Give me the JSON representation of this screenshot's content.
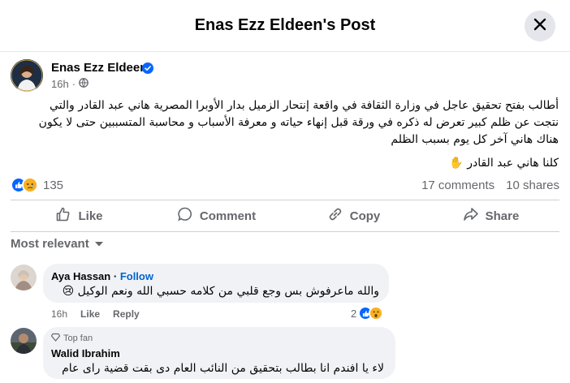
{
  "header": {
    "title": "Enas Ezz Eldeen's Post"
  },
  "post": {
    "author": "Enas Ezz Eldeen",
    "time": "16h",
    "lines": [
      "أطالب بفتح تحقيق عاجل في وزارة الثقافة في واقعة إنتحار الزميل بدار الأوبرا المصرية هاني عبد القادر والتي",
      "نتجت عن ظلم كبير تعرض له ذكره في ورقة قبل إنهاء حياته و معرفة الأسباب و محاسبة المتسببين حتى لا يكون",
      "هناك هاني آخر كل يوم بسبب الظلم"
    ],
    "tagline": "كلنا هاني عبد القادر ✋",
    "reaction_count": "135",
    "comments": "17 comments",
    "shares": "10 shares"
  },
  "actions": {
    "like": "Like",
    "comment": "Comment",
    "copy": "Copy",
    "share": "Share"
  },
  "sort": {
    "label": "Most relevant"
  },
  "comments": [
    {
      "name": "Aya Hassan",
      "follow": "Follow",
      "text": "والله ماعرفوش بس وجع قلبي من كلامه حسبي الله ونعم الوكيل 😢",
      "time": "16h",
      "like": "Like",
      "reply": "Reply",
      "reactions": "2"
    },
    {
      "badge": "Top fan",
      "name": "Walid Ibrahim",
      "text": "لاء يا افندم انا بطالب بتحقيق من النائب العام دى بقت قضية راى عام"
    }
  ],
  "colors": {
    "accent": "#0866ff",
    "muted": "#65676b",
    "bubble": "#f0f2f5"
  }
}
